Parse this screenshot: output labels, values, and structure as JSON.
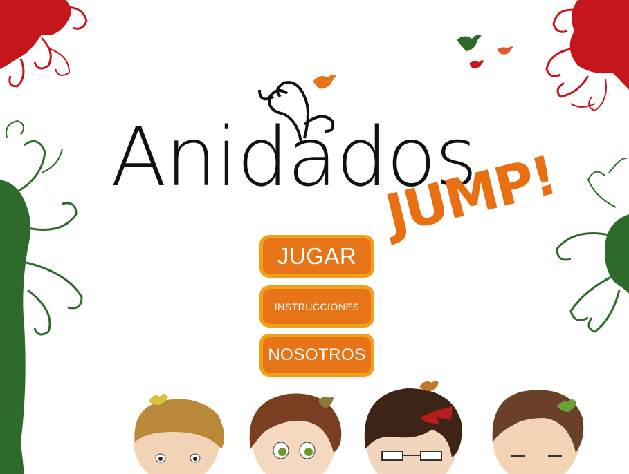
{
  "game": {
    "title": "Anidados",
    "subtitle": "JUMP!"
  },
  "menu": {
    "play_label": "JUGAR",
    "instructions_label": "INSTRUCCIONES",
    "about_label": "NOSOTROS"
  },
  "colors": {
    "button_outer": "#f0a019",
    "button_inner": "#e87418",
    "jump_orange": "#e86f12",
    "tree_red": "#c4161c",
    "tree_green": "#2e6b2a",
    "title_black": "#111111"
  }
}
